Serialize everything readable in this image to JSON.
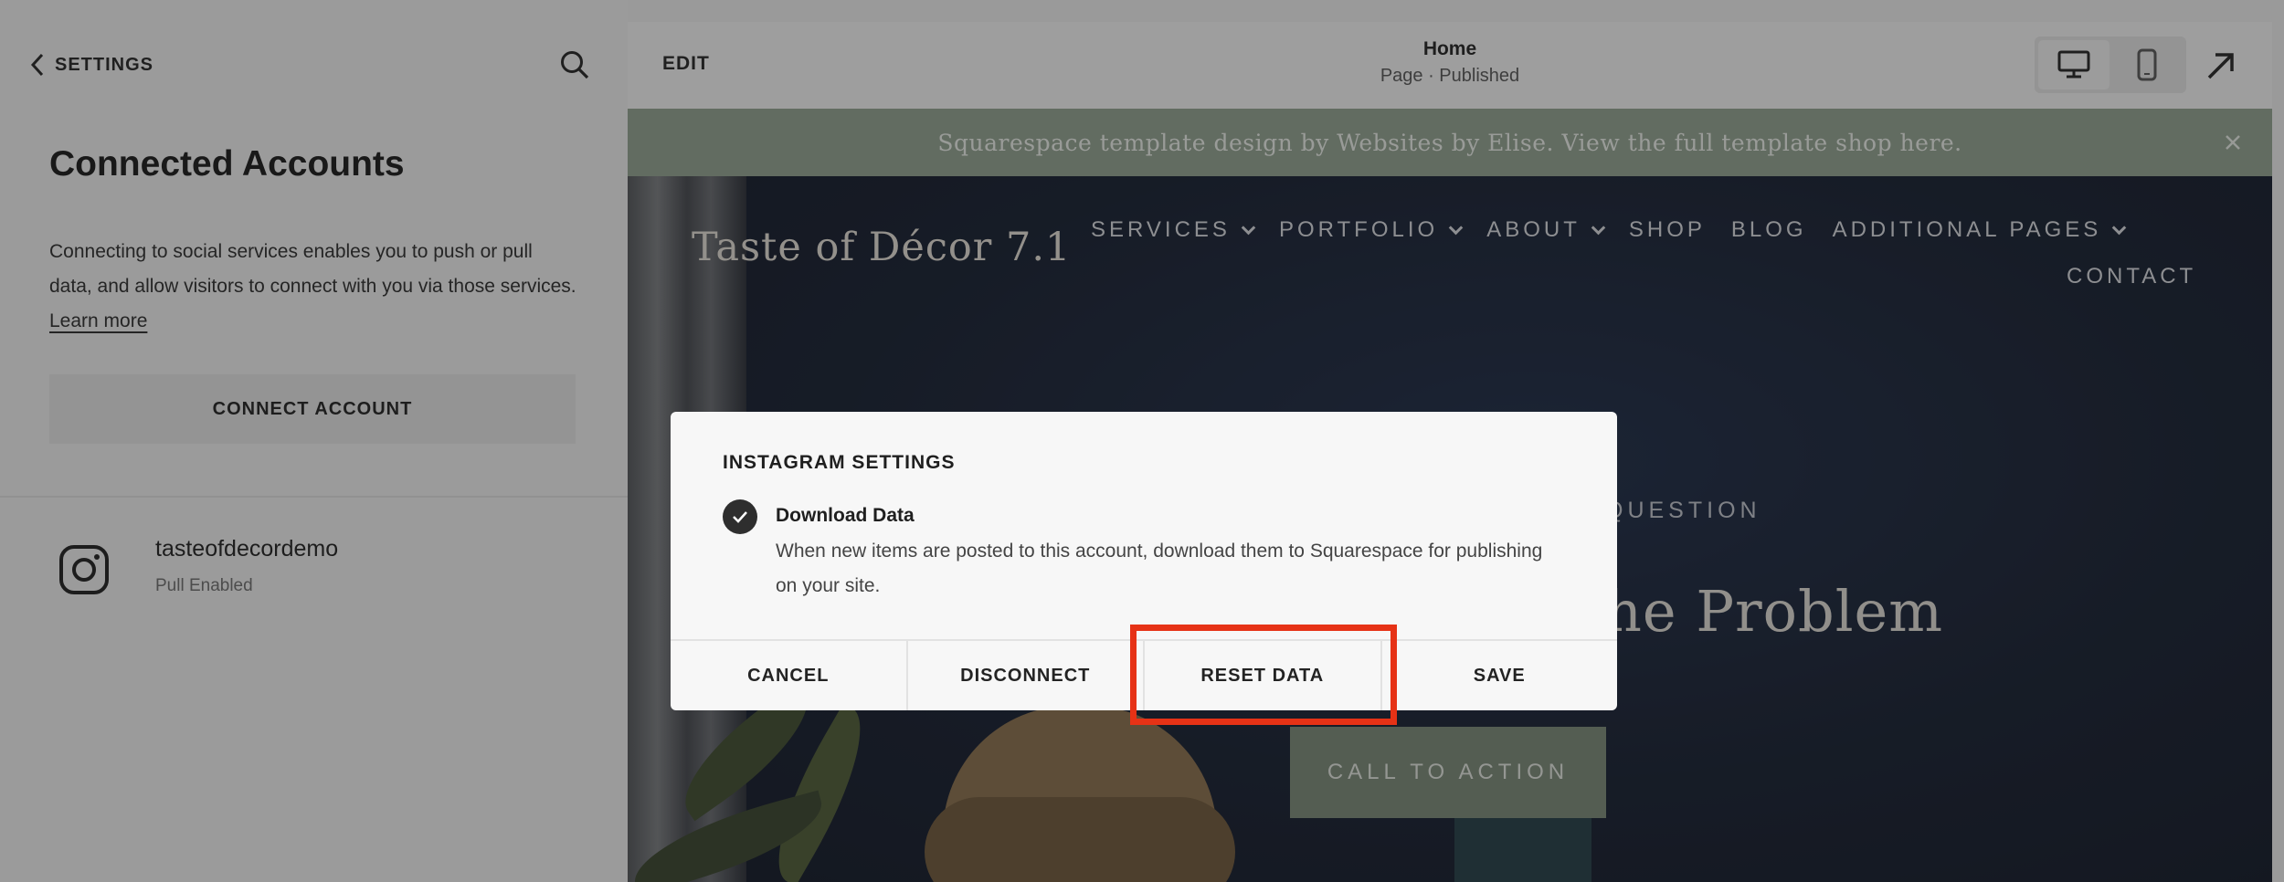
{
  "sidebar": {
    "back_label": "SETTINGS",
    "title": "Connected Accounts",
    "description": "Connecting to social services enables you to push or pull data, and allow visitors to connect with you via those services.",
    "learn_more": "Learn more",
    "connect_button": "CONNECT ACCOUNT",
    "accounts": [
      {
        "name": "tasteofdecordemo",
        "status": "Pull Enabled",
        "icon": "instagram-icon"
      }
    ]
  },
  "topbar": {
    "edit_label": "EDIT",
    "page_title": "Home",
    "page_status": "Page · Published",
    "icons": [
      "desktop-icon",
      "mobile-icon",
      "open-external-icon"
    ]
  },
  "site": {
    "announcement": "Squarespace template design by Websites by Elise. View the full template shop here.",
    "site_title": "Taste of Décor 7.1",
    "nav": [
      "SERVICES",
      "PORTFOLIO",
      "ABOUT",
      "SHOP",
      "BLOG",
      "ADDITIONAL PAGES",
      "CONTACT"
    ],
    "hero_kicker": "QUESTION",
    "hero_heading": "he Problem",
    "cta": "CALL TO ACTION"
  },
  "modal": {
    "title": "INSTAGRAM SETTINGS",
    "option_label": "Download Data",
    "option_checked": true,
    "option_desc": "When new items are posted to this account, download them to Squarespace for publishing on your site.",
    "buttons": {
      "cancel": "CANCEL",
      "disconnect": "DISCONNECT",
      "reset": "RESET DATA",
      "save": "SAVE"
    }
  },
  "colors": {
    "highlight": "#e63216",
    "announcement_bg": "#93a491",
    "cta_bg": "#7a8a78"
  }
}
